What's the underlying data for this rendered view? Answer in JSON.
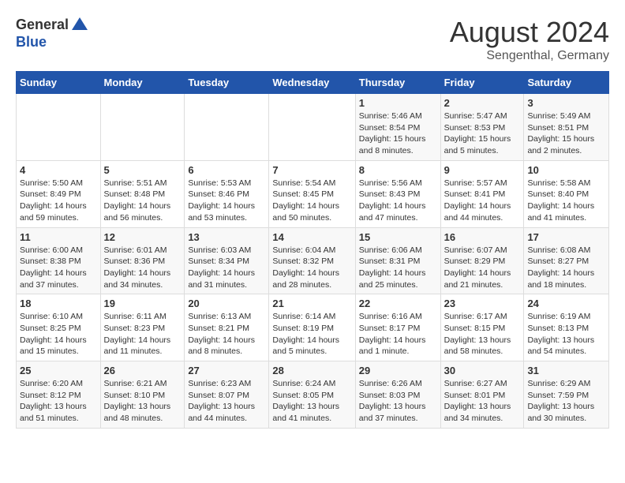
{
  "header": {
    "logo_general": "General",
    "logo_blue": "Blue",
    "month_title": "August 2024",
    "location": "Sengenthal, Germany"
  },
  "days_of_week": [
    "Sunday",
    "Monday",
    "Tuesday",
    "Wednesday",
    "Thursday",
    "Friday",
    "Saturday"
  ],
  "weeks": [
    [
      {
        "day": "",
        "info": ""
      },
      {
        "day": "",
        "info": ""
      },
      {
        "day": "",
        "info": ""
      },
      {
        "day": "",
        "info": ""
      },
      {
        "day": "1",
        "info": "Sunrise: 5:46 AM\nSunset: 8:54 PM\nDaylight: 15 hours and 8 minutes."
      },
      {
        "day": "2",
        "info": "Sunrise: 5:47 AM\nSunset: 8:53 PM\nDaylight: 15 hours and 5 minutes."
      },
      {
        "day": "3",
        "info": "Sunrise: 5:49 AM\nSunset: 8:51 PM\nDaylight: 15 hours and 2 minutes."
      }
    ],
    [
      {
        "day": "4",
        "info": "Sunrise: 5:50 AM\nSunset: 8:49 PM\nDaylight: 14 hours and 59 minutes."
      },
      {
        "day": "5",
        "info": "Sunrise: 5:51 AM\nSunset: 8:48 PM\nDaylight: 14 hours and 56 minutes."
      },
      {
        "day": "6",
        "info": "Sunrise: 5:53 AM\nSunset: 8:46 PM\nDaylight: 14 hours and 53 minutes."
      },
      {
        "day": "7",
        "info": "Sunrise: 5:54 AM\nSunset: 8:45 PM\nDaylight: 14 hours and 50 minutes."
      },
      {
        "day": "8",
        "info": "Sunrise: 5:56 AM\nSunset: 8:43 PM\nDaylight: 14 hours and 47 minutes."
      },
      {
        "day": "9",
        "info": "Sunrise: 5:57 AM\nSunset: 8:41 PM\nDaylight: 14 hours and 44 minutes."
      },
      {
        "day": "10",
        "info": "Sunrise: 5:58 AM\nSunset: 8:40 PM\nDaylight: 14 hours and 41 minutes."
      }
    ],
    [
      {
        "day": "11",
        "info": "Sunrise: 6:00 AM\nSunset: 8:38 PM\nDaylight: 14 hours and 37 minutes."
      },
      {
        "day": "12",
        "info": "Sunrise: 6:01 AM\nSunset: 8:36 PM\nDaylight: 14 hours and 34 minutes."
      },
      {
        "day": "13",
        "info": "Sunrise: 6:03 AM\nSunset: 8:34 PM\nDaylight: 14 hours and 31 minutes."
      },
      {
        "day": "14",
        "info": "Sunrise: 6:04 AM\nSunset: 8:32 PM\nDaylight: 14 hours and 28 minutes."
      },
      {
        "day": "15",
        "info": "Sunrise: 6:06 AM\nSunset: 8:31 PM\nDaylight: 14 hours and 25 minutes."
      },
      {
        "day": "16",
        "info": "Sunrise: 6:07 AM\nSunset: 8:29 PM\nDaylight: 14 hours and 21 minutes."
      },
      {
        "day": "17",
        "info": "Sunrise: 6:08 AM\nSunset: 8:27 PM\nDaylight: 14 hours and 18 minutes."
      }
    ],
    [
      {
        "day": "18",
        "info": "Sunrise: 6:10 AM\nSunset: 8:25 PM\nDaylight: 14 hours and 15 minutes."
      },
      {
        "day": "19",
        "info": "Sunrise: 6:11 AM\nSunset: 8:23 PM\nDaylight: 14 hours and 11 minutes."
      },
      {
        "day": "20",
        "info": "Sunrise: 6:13 AM\nSunset: 8:21 PM\nDaylight: 14 hours and 8 minutes."
      },
      {
        "day": "21",
        "info": "Sunrise: 6:14 AM\nSunset: 8:19 PM\nDaylight: 14 hours and 5 minutes."
      },
      {
        "day": "22",
        "info": "Sunrise: 6:16 AM\nSunset: 8:17 PM\nDaylight: 14 hours and 1 minute."
      },
      {
        "day": "23",
        "info": "Sunrise: 6:17 AM\nSunset: 8:15 PM\nDaylight: 13 hours and 58 minutes."
      },
      {
        "day": "24",
        "info": "Sunrise: 6:19 AM\nSunset: 8:13 PM\nDaylight: 13 hours and 54 minutes."
      }
    ],
    [
      {
        "day": "25",
        "info": "Sunrise: 6:20 AM\nSunset: 8:12 PM\nDaylight: 13 hours and 51 minutes."
      },
      {
        "day": "26",
        "info": "Sunrise: 6:21 AM\nSunset: 8:10 PM\nDaylight: 13 hours and 48 minutes."
      },
      {
        "day": "27",
        "info": "Sunrise: 6:23 AM\nSunset: 8:07 PM\nDaylight: 13 hours and 44 minutes."
      },
      {
        "day": "28",
        "info": "Sunrise: 6:24 AM\nSunset: 8:05 PM\nDaylight: 13 hours and 41 minutes."
      },
      {
        "day": "29",
        "info": "Sunrise: 6:26 AM\nSunset: 8:03 PM\nDaylight: 13 hours and 37 minutes."
      },
      {
        "day": "30",
        "info": "Sunrise: 6:27 AM\nSunset: 8:01 PM\nDaylight: 13 hours and 34 minutes."
      },
      {
        "day": "31",
        "info": "Sunrise: 6:29 AM\nSunset: 7:59 PM\nDaylight: 13 hours and 30 minutes."
      }
    ]
  ]
}
